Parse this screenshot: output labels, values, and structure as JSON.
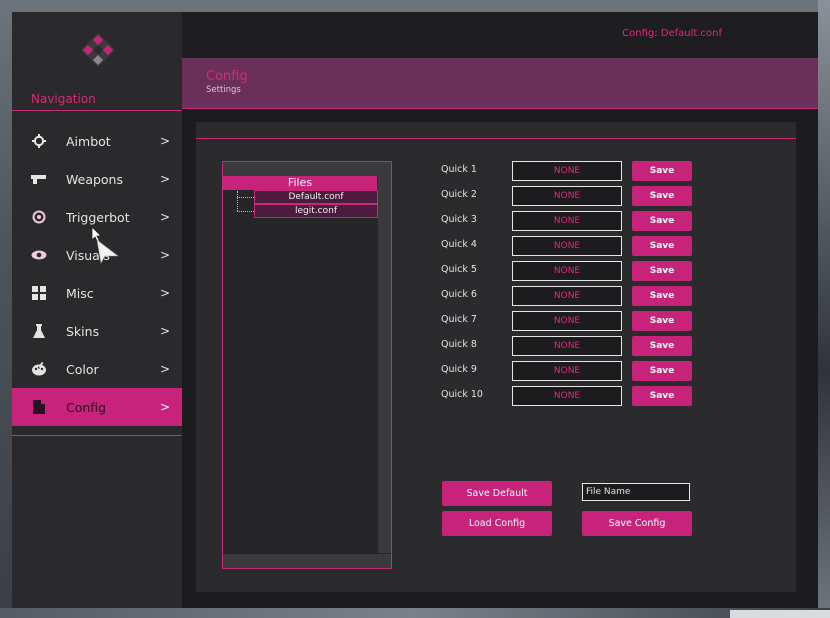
{
  "window": {
    "config_indicator": "Config: Default.conf"
  },
  "sidebar": {
    "title": "Navigation",
    "items": [
      {
        "label": "Aimbot",
        "arrow": ">",
        "icon": "crosshair-icon"
      },
      {
        "label": "Weapons",
        "arrow": ">",
        "icon": "gun-icon"
      },
      {
        "label": "Triggerbot",
        "arrow": ">",
        "icon": "target-icon"
      },
      {
        "label": "Visuals",
        "arrow": ">",
        "icon": "eye-icon"
      },
      {
        "label": "Misc",
        "arrow": ">",
        "icon": "grid-icon"
      },
      {
        "label": "Skins",
        "arrow": ">",
        "icon": "flask-icon"
      },
      {
        "label": "Color",
        "arrow": ">",
        "icon": "palette-icon"
      },
      {
        "label": "Config",
        "arrow": ">",
        "icon": "file-icon",
        "active": true
      }
    ]
  },
  "header": {
    "title": "Config",
    "subtitle": "Settings"
  },
  "files": {
    "header": "Files",
    "items": [
      "Default.conf",
      "legit.conf"
    ]
  },
  "quick_slots": [
    {
      "label": "Quick 1",
      "value": "NONE",
      "save": "Save"
    },
    {
      "label": "Quick 2",
      "value": "NONE",
      "save": "Save"
    },
    {
      "label": "Quick 3",
      "value": "NONE",
      "save": "Save"
    },
    {
      "label": "Quick 4",
      "value": "NONE",
      "save": "Save"
    },
    {
      "label": "Quick 5",
      "value": "NONE",
      "save": "Save"
    },
    {
      "label": "Quick 6",
      "value": "NONE",
      "save": "Save"
    },
    {
      "label": "Quick 7",
      "value": "NONE",
      "save": "Save"
    },
    {
      "label": "Quick 8",
      "value": "NONE",
      "save": "Save"
    },
    {
      "label": "Quick 9",
      "value": "NONE",
      "save": "Save"
    },
    {
      "label": "Quick 10",
      "value": "NONE",
      "save": "Save"
    }
  ],
  "actions": {
    "save_default": "Save Default",
    "load_config": "Load Config",
    "save_config": "Save Config",
    "file_name_value": "File Name"
  },
  "colors": {
    "accent": "#c8237a",
    "header_band": "#6b2f5c",
    "sidebar_bg": "#2a2a2c",
    "panel_bg": "#2b2a2c"
  }
}
